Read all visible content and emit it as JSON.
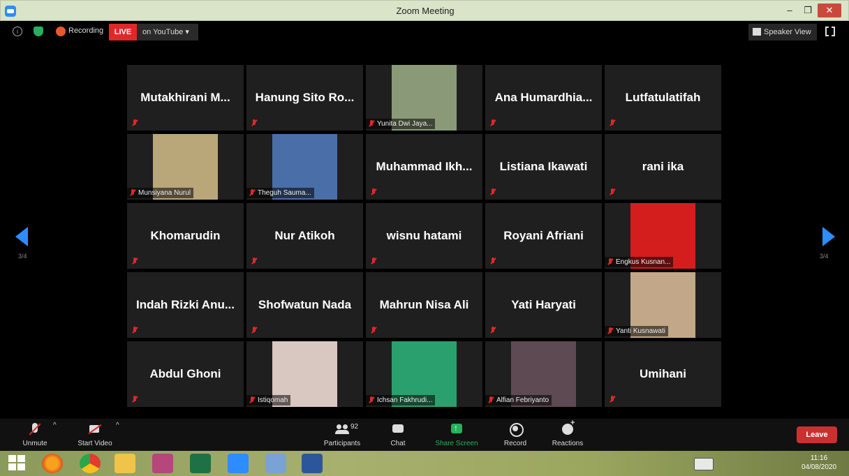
{
  "window": {
    "title": "Zoom Meeting",
    "minimize": "–",
    "maximize": "❐",
    "close": "✕"
  },
  "topbar": {
    "info": "i",
    "recording_label": "Recording",
    "live_badge": "LIVE",
    "youtube_label": "on YouTube ▾",
    "speaker_view_label": "Speaker View"
  },
  "pagination": {
    "left": "3/4",
    "right": "3/4"
  },
  "participants": [
    {
      "name": "Mutakhirani M...",
      "video": false
    },
    {
      "name": "Hanung Sito Ro...",
      "video": false
    },
    {
      "name": "Yunita Dwi Jaya...",
      "video": true,
      "color": "#8a9a78"
    },
    {
      "name": "Ana Humardhia...",
      "video": false
    },
    {
      "name": "Lutfatulatifah",
      "video": false
    },
    {
      "name": "Munsiyana Nurul",
      "video": true,
      "color": "#b9a77a"
    },
    {
      "name": "Theguh Sauma...",
      "video": true,
      "color": "#4a6fa8"
    },
    {
      "name": "Muhammad Ikh...",
      "video": false
    },
    {
      "name": "Listiana Ikawati",
      "video": false
    },
    {
      "name": "rani ika",
      "video": false
    },
    {
      "name": "Khomarudin",
      "video": false
    },
    {
      "name": "Nur Atikoh",
      "video": false
    },
    {
      "name": "wisnu hatami",
      "video": false
    },
    {
      "name": "Royani Afriani",
      "video": false
    },
    {
      "name": "Engkus Kusnan...",
      "video": true,
      "color": "#d41e1e"
    },
    {
      "name": "Indah Rizki Anu...",
      "video": false
    },
    {
      "name": "Shofwatun Nada",
      "video": false
    },
    {
      "name": "Mahrun Nisa Ali",
      "video": false
    },
    {
      "name": "Yati Haryati",
      "video": false
    },
    {
      "name": "Yanti Kusnawati",
      "video": true,
      "color": "#c2a888"
    },
    {
      "name": "Abdul Ghoni",
      "video": false
    },
    {
      "name": "Istiqomah",
      "video": true,
      "color": "#d9c7c2"
    },
    {
      "name": "Ichsan Fakhrudi...",
      "video": true,
      "color": "#2aa06e"
    },
    {
      "name": "Alfian Febriyanto",
      "video": true,
      "color": "#5e4a52"
    },
    {
      "name": "Umihani",
      "video": false
    }
  ],
  "controls": {
    "unmute": "Unmute",
    "start_video": "Start Video",
    "participants": "Participants",
    "participants_count": "92",
    "chat": "Chat",
    "share_screen": "Share Screen",
    "record": "Record",
    "reactions": "Reactions",
    "leave": "Leave",
    "chevron": "^"
  },
  "colors": {
    "accent": "#2d8cff",
    "live": "#e02828",
    "share": "#23b35a",
    "leave": "#c93131"
  },
  "taskbar": {
    "apps": [
      "windows-start",
      "firefox",
      "chrome",
      "file-explorer",
      "paint-app",
      "excel",
      "zoom",
      "paint",
      "word"
    ],
    "time": "11:16",
    "date": "04/08/2020"
  }
}
